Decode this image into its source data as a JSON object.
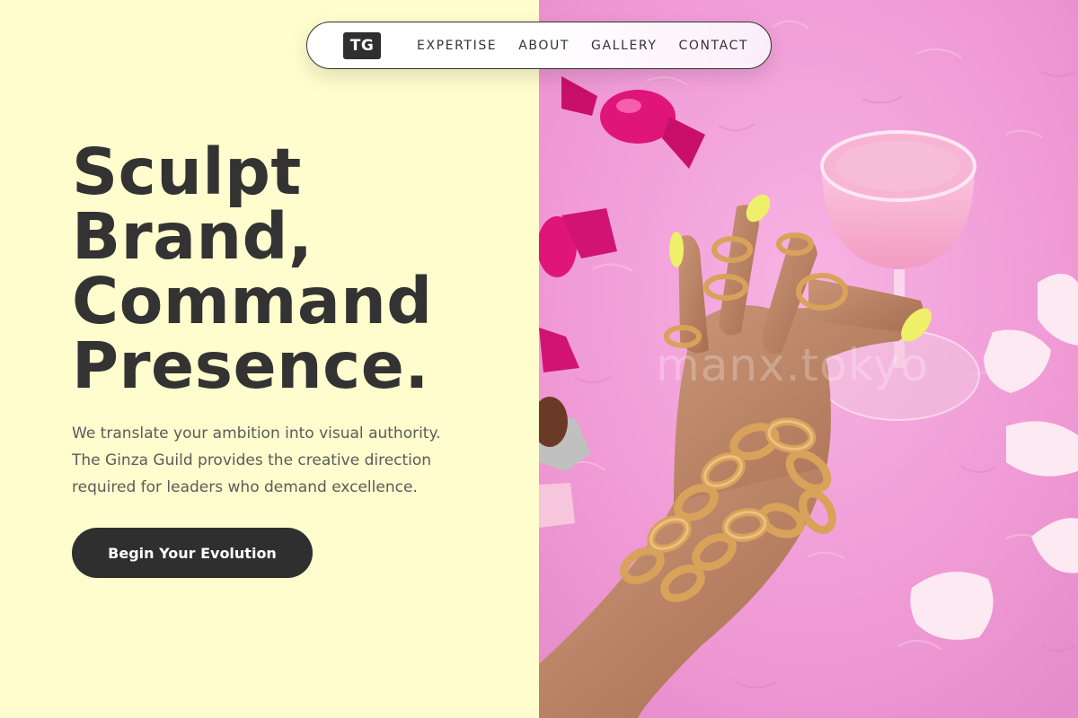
{
  "nav": {
    "logo": "TG",
    "links": [
      "EXPERTISE",
      "ABOUT",
      "GALLERY",
      "CONTACT"
    ]
  },
  "hero": {
    "title_lines": [
      "Sculpt",
      "Brand,",
      "Command",
      "Presence."
    ],
    "description_lines": [
      "We translate your ambition into visual authority.",
      "The Ginza Guild provides the creative direction",
      "required for leaders who demand excellence."
    ],
    "cta_label": "Begin Your Evolution"
  },
  "image": {
    "watermark": "manx.tokyo",
    "subject": "hand-with-gold-chain-bracelets-and-cocktail-on-pink-fur"
  },
  "colors": {
    "background": "#fffccd",
    "text_dark": "#333333",
    "text_muted": "#5b5b5b",
    "button": "#2f2f2f",
    "fur_pink": "#f29ad6",
    "gold": "#d9a25a",
    "nail_yellow": "#eef06a",
    "candy_magenta": "#e0157a"
  }
}
